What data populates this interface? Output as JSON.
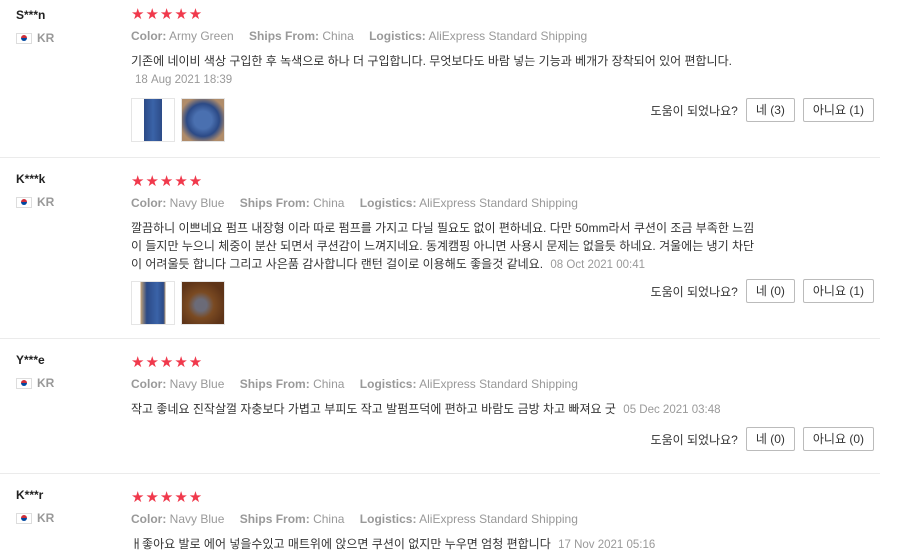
{
  "helpful_label": "도움이 되었나요?",
  "stars": "★★★★★",
  "labels": {
    "color": "Color:",
    "ships_from": "Ships From:",
    "logistics": "Logistics:"
  },
  "reviews": [
    {
      "user": "S***n",
      "country": "KR",
      "color": "Army Green",
      "ships_from": "China",
      "logistics": "AliExpress Standard Shipping",
      "text": "기존에 네이비 색상 구입한 후 녹색으로 하나 더 구입합니다. 무엇보다도 바람 넣는 기능과 베개가 장착되어 있어 편합니다.",
      "date": "18 Aug 2021 18:39",
      "yes": "네 (3)",
      "no": "아니요 (1)"
    },
    {
      "user": "K***k",
      "country": "KR",
      "color": "Navy Blue",
      "ships_from": "China",
      "logistics": "AliExpress Standard Shipping",
      "text": "깔끔하니 이쁘네요 펌프 내장형 이라 따로 펌프를 가지고 다닐 필요도 없이 편하네요. 다만 50mm라서 쿠션이 조금 부족한 느낌이 들지만 누으니 체중이 분산 되면서 쿠션감이 느껴지네요. 동계캠핑 아니면 사용시 문제는 없을듯 하네요. 겨울에는 냉기 차단이 어려울듯 합니다 그리고 사은품 감사합니다 랜턴 걸이로 이용해도 좋을것 같네요.",
      "date": "08 Oct 2021 00:41",
      "yes": "네 (0)",
      "no": "아니요 (1)"
    },
    {
      "user": "Y***e",
      "country": "KR",
      "color": "Navy Blue",
      "ships_from": "China",
      "logistics": "AliExpress Standard Shipping",
      "text": "작고 좋네요 진작살껄 자충보다 가볍고 부피도 작고 발펌프덕에 편하고 바람도 금방 차고 빠져요 굿",
      "date": "05 Dec 2021 03:48",
      "yes": "네 (0)",
      "no": "아니요 (0)"
    },
    {
      "user": "K***r",
      "country": "KR",
      "color": "Navy Blue",
      "ships_from": "China",
      "logistics": "AliExpress Standard Shipping",
      "text": "ㅐ좋아요 발로 에어 넣을수있고 매트위에 앉으면 쿠션이 없지만 누우면 엄청 편합니다",
      "date": "17 Nov 2021 05:16"
    }
  ]
}
